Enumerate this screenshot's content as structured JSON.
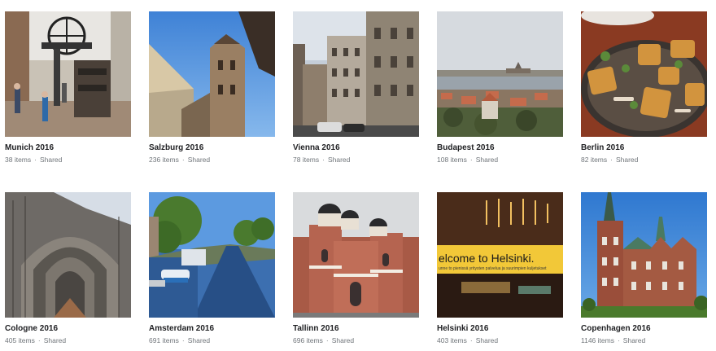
{
  "albums": [
    {
      "title": "Munich 2016",
      "count": "38 items",
      "status": "Shared"
    },
    {
      "title": "Salzburg 2016",
      "count": "236 items",
      "status": "Shared"
    },
    {
      "title": "Vienna 2016",
      "count": "78 items",
      "status": "Shared"
    },
    {
      "title": "Budapest 2016",
      "count": "108 items",
      "status": "Shared"
    },
    {
      "title": "Berlin 2016",
      "count": "82 items",
      "status": "Shared"
    },
    {
      "title": "Cologne 2016",
      "count": "405 items",
      "status": "Shared"
    },
    {
      "title": "Amsterdam 2016",
      "count": "691 items",
      "status": "Shared"
    },
    {
      "title": "Tallinn 2016",
      "count": "696 items",
      "status": "Shared"
    },
    {
      "title": "Helsinki 2016",
      "count": "403 items",
      "status": "Shared"
    },
    {
      "title": "Copenhagen 2016",
      "count": "1146 items",
      "status": "Shared"
    }
  ],
  "separator": "·",
  "sign_text": {
    "line1": "elcome to Helsinki.",
    "line2": "unne to pienissä yritysten palvelua ja suurimpien kuljetukset"
  }
}
